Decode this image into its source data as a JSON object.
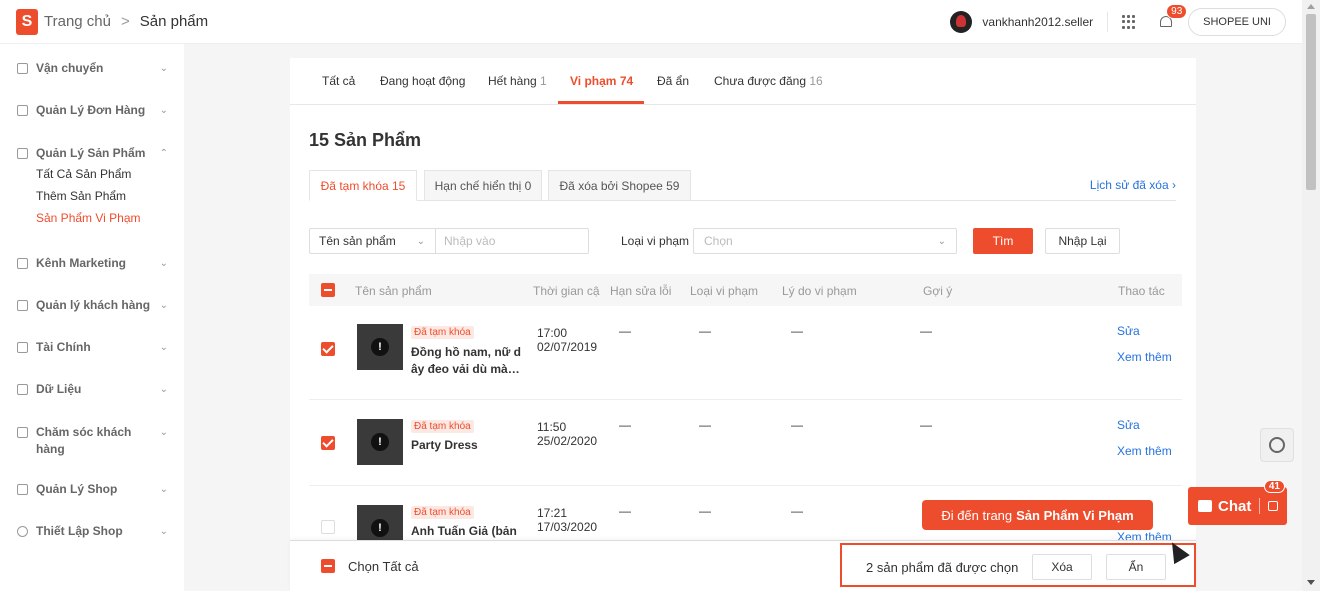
{
  "header": {
    "logo_letter": "S",
    "breadcrumb_home": "Trang chủ",
    "breadcrumb_sep": ">",
    "breadcrumb_current": "Sản phẩm",
    "username": "vankhanh2012.seller",
    "notification_count": "93",
    "shopee_uni": "SHOPEE UNI"
  },
  "sidebar": {
    "groups": [
      {
        "label": "Vận chuyển"
      },
      {
        "label": "Quản Lý Đơn Hàng"
      },
      {
        "label": "Quản Lý Sản Phẩm",
        "items": [
          "Tất Cả Sản Phẩm",
          "Thêm Sản Phẩm",
          "Sản Phẩm Vi Phạm"
        ]
      },
      {
        "label": "Kênh Marketing"
      },
      {
        "label": "Quản lý khách hàng"
      },
      {
        "label": "Tài Chính"
      },
      {
        "label": "Dữ Liệu"
      },
      {
        "label": "Chăm sóc khách",
        "label2": "hàng"
      },
      {
        "label": "Quản Lý Shop"
      },
      {
        "label": "Thiết Lập Shop"
      }
    ]
  },
  "tabs": [
    {
      "label": "Tất cả",
      "count": ""
    },
    {
      "label": "Đang hoạt động",
      "count": ""
    },
    {
      "label": "Hết hàng",
      "count": "1"
    },
    {
      "label": "Vi phạm",
      "count": "74",
      "active": true
    },
    {
      "label": "Đã ẩn",
      "count": ""
    },
    {
      "label": "Chưa được đăng",
      "count": "16"
    }
  ],
  "page_title": "15 Sản Phẩm",
  "subtabs": [
    "Đã tạm khóa 15",
    "Hạn chế hiển thị 0",
    "Đã xóa bởi Shopee 59"
  ],
  "history_link": "Lịch sử đã xóa",
  "filter": {
    "field_label": "Tên sản phẩm",
    "input_placeholder": "Nhập vào",
    "violation_label": "Loại vi phạm",
    "violation_placeholder": "Chọn",
    "search_button": "Tìm",
    "reset_button": "Nhập Lại"
  },
  "table": {
    "headers": [
      "Tên sản phẩm",
      "Thời gian cậ",
      "Hạn sửa lỗi",
      "Loại vi phạm",
      "Lý do vi phạm",
      "Gợi ý",
      "Thao tác"
    ],
    "rows": [
      {
        "tag": "Đã tạm khóa",
        "name_line1": "Đồng hồ nam, nữ d",
        "name_line2": "ây đeo vải dù mà…",
        "time": "17:00",
        "date": "02/07/2019",
        "checked": true,
        "dash": "—",
        "edit": "Sửa",
        "more": "Xem thêm"
      },
      {
        "tag": "Đã tạm khóa",
        "name_line1": "Party Dress",
        "name_line2": "",
        "time": "11:50",
        "date": "25/02/2020",
        "checked": true,
        "dash": "—",
        "edit": "Sửa",
        "more": "Xem thêm"
      },
      {
        "tag": "Đã tạm khóa",
        "name_line1": "Anh Tuấn Giả (bản",
        "name_line2": "",
        "time": "17:21",
        "date": "17/03/2020",
        "checked": false,
        "dash": "—",
        "edit": "",
        "more": "Xem thêm"
      }
    ]
  },
  "footer": {
    "select_all": "Chọn Tất cả",
    "selected_text": "2 sản phẩm đã được chọn",
    "delete_button": "Xóa",
    "hide_button": "Ẩn"
  },
  "tooltip": {
    "prefix": "Đi đến trang",
    "bold": "Sản Phẩm Vi Phạm"
  },
  "chat": {
    "label": "Chat",
    "badge": "41"
  },
  "colors": {
    "brand": "#ee4d2d",
    "link": "#2673dd"
  }
}
